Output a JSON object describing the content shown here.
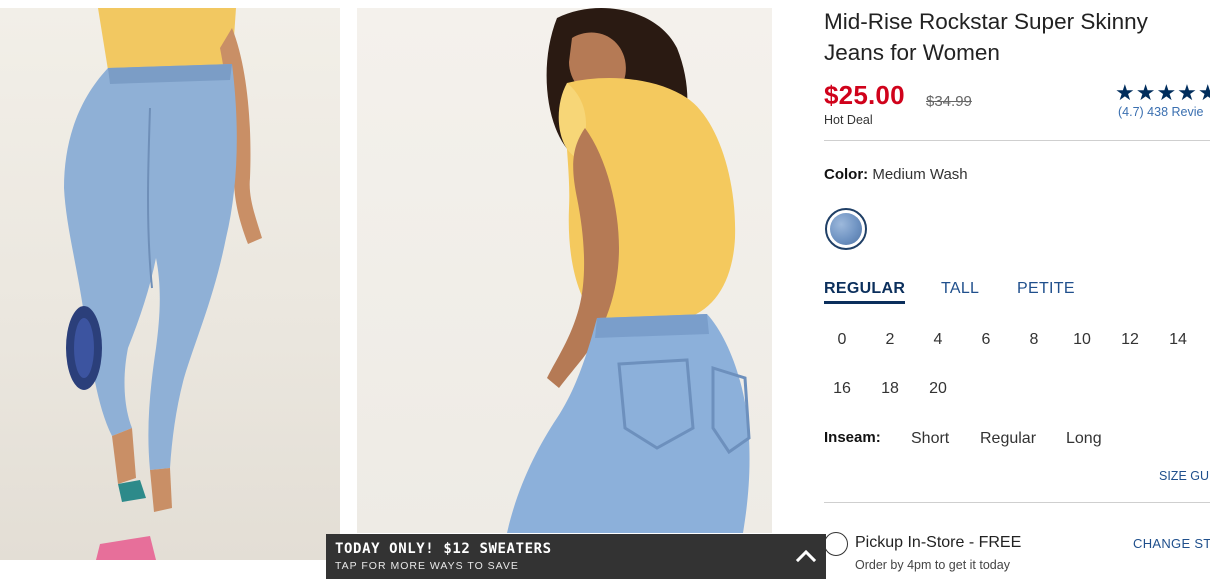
{
  "product": {
    "title": "Mid-Rise Rockstar Super Skinny Jeans for Women",
    "price": "$25.00",
    "original_price": "$34.99",
    "deal_label": "Hot Deal",
    "stars": "★★★★★",
    "rating_text": "(4.7) 438 Revie"
  },
  "color": {
    "label": "Color:",
    "value": "Medium Wash",
    "swatch_hex": "#6f93c2"
  },
  "fit_tabs": [
    "REGULAR",
    "TALL",
    "PETITE"
  ],
  "active_fit": "REGULAR",
  "sizes": [
    "0",
    "2",
    "4",
    "6",
    "8",
    "10",
    "12",
    "14",
    "16",
    "18",
    "20"
  ],
  "inseam": {
    "label": "Inseam:",
    "options": [
      "Short",
      "Regular",
      "Long"
    ]
  },
  "size_guide": "SIZE GUI",
  "pickup": {
    "label": "Pickup In-Store - FREE",
    "sub": "Order by 4pm to get it today",
    "change_store": "CHANGE STO"
  },
  "promo": {
    "title": "TODAY ONLY! $12 SWEATERS",
    "subtitle": "TAP FOR MORE WAYS TO SAVE"
  },
  "colors": {
    "sale_red": "#d0021b",
    "navy": "#0b2f5c",
    "link_blue": "#1f4f8c",
    "promo_bg": "#333333"
  }
}
